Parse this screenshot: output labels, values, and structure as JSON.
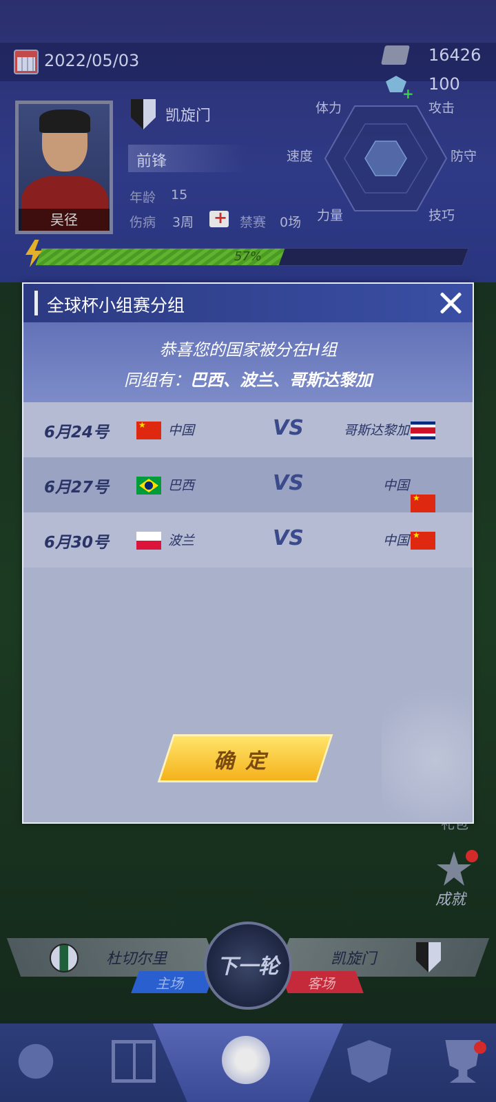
{
  "status": {
    "date": "2022/05/03",
    "money": "16426",
    "gems": "100"
  },
  "player": {
    "name": "吴径",
    "club": "凯旋门",
    "position": "前锋",
    "age_label": "年龄",
    "age_value": "15",
    "injury_label": "伤病",
    "injury_value": "3周",
    "ban_label": "禁赛",
    "ban_value": "0场",
    "energy_percent": "57%",
    "energy_fraction": 0.57
  },
  "radar": {
    "stamina": "体力",
    "attack": "攻击",
    "speed": "速度",
    "defense": "防守",
    "strength": "力量",
    "skill": "技巧"
  },
  "modal": {
    "title": "全球杯小组赛分组",
    "message_line1": "恭喜您的国家被分在H组",
    "message_line2_prefix": "同组有：",
    "message_line2_teams": "巴西、波兰、哥斯达黎加",
    "vs_label": "VS",
    "matches": [
      {
        "date": "6月24号",
        "left_team": "中国",
        "left_flag": "flag-cn",
        "right_team": "哥斯达黎加",
        "right_flag": "flag-cr"
      },
      {
        "date": "6月27号",
        "left_team": "巴西",
        "left_flag": "flag-br",
        "right_team": "中国",
        "right_flag": "flag-cn"
      },
      {
        "date": "6月30号",
        "left_team": "波兰",
        "left_flag": "flag-pl",
        "right_team": "中国",
        "right_flag": "flag-cn"
      }
    ],
    "confirm_label": "确定"
  },
  "fixture": {
    "home_team": "杜切尔里",
    "away_team": "凯旋门",
    "home_tag": "主场",
    "away_tag": "客场",
    "next_round_label": "下一轮"
  },
  "side": {
    "achievement_label": "成就",
    "partial_label": "礼包"
  },
  "icons": {
    "calendar": "calendar-icon",
    "money": "money-icon",
    "gem": "gem-icon",
    "close": "close-icon",
    "energy": "lightning-icon",
    "medical": "medical-kit-icon"
  }
}
